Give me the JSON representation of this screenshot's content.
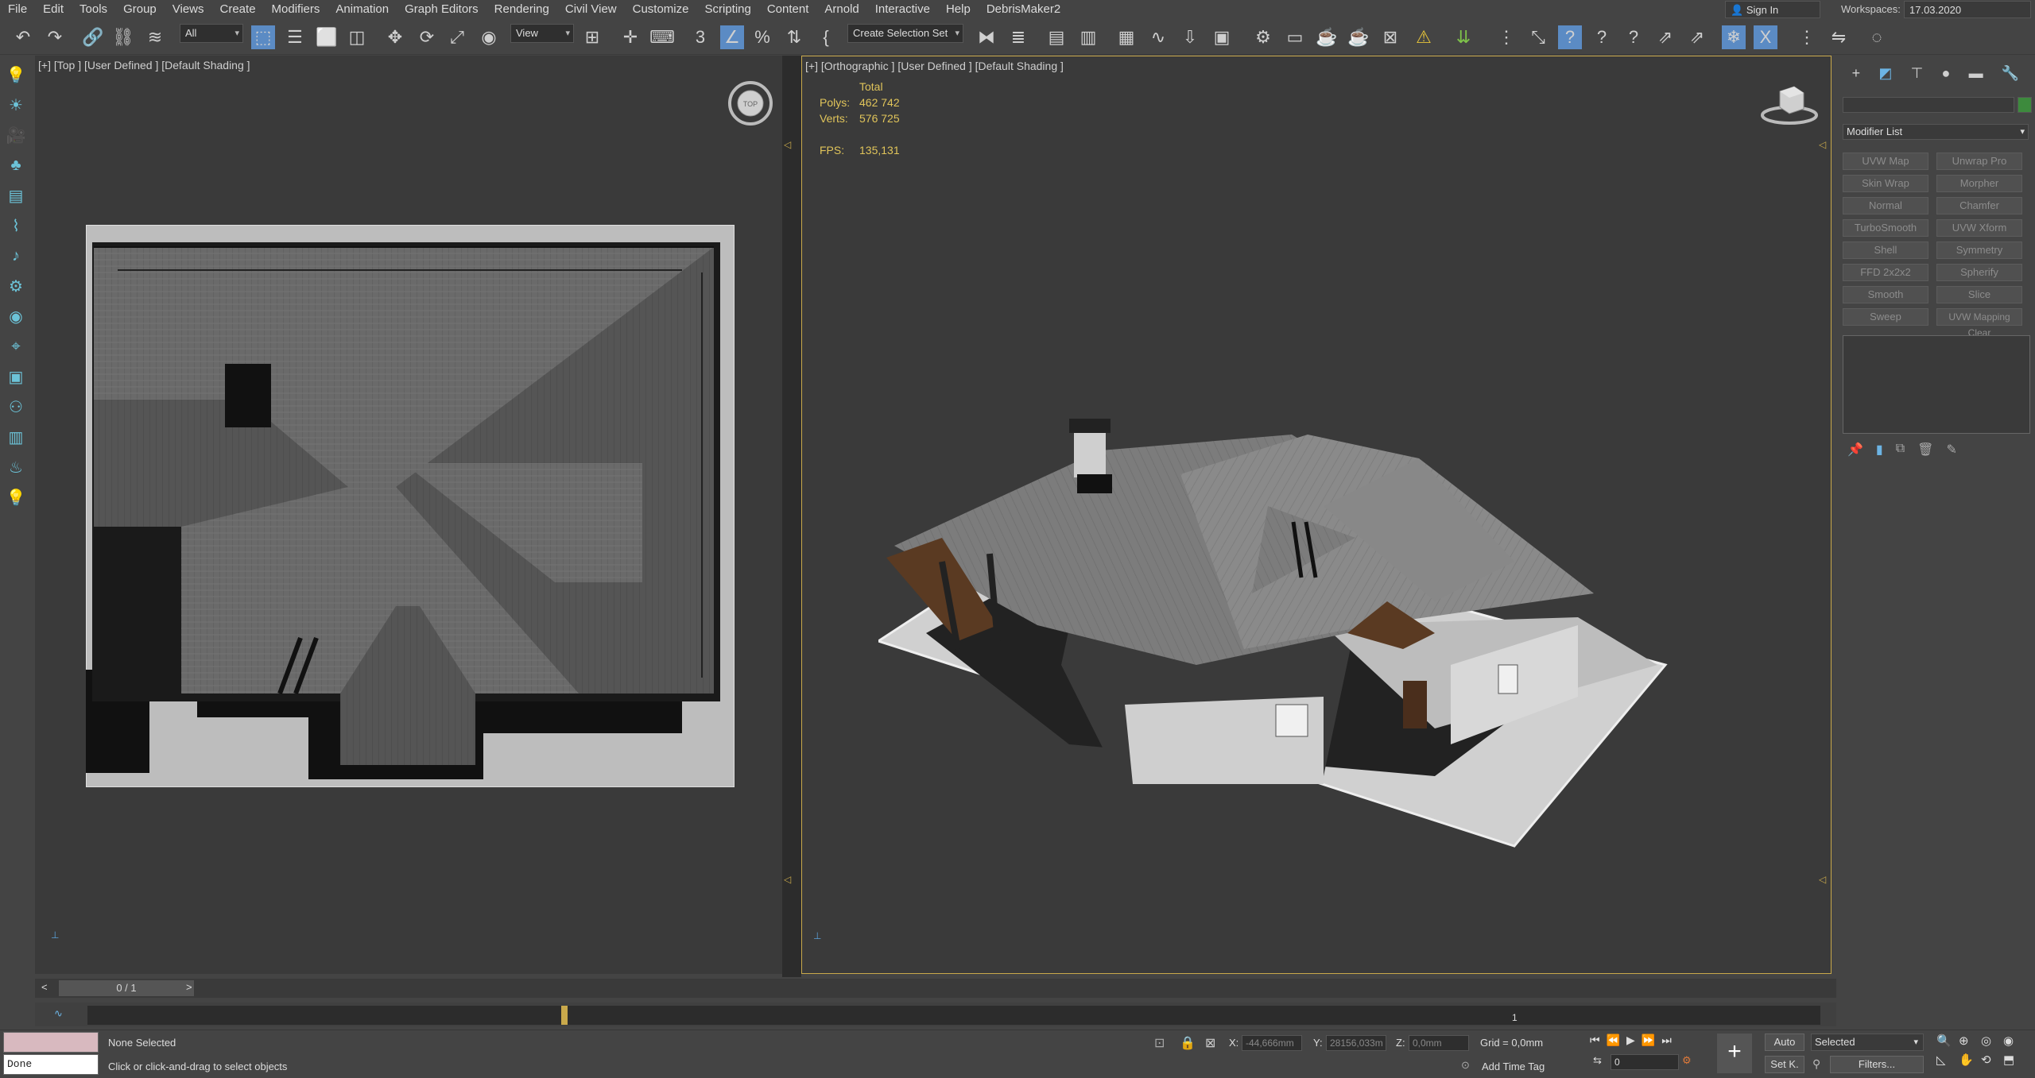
{
  "menu": [
    "File",
    "Edit",
    "Tools",
    "Group",
    "Views",
    "Create",
    "Modifiers",
    "Animation",
    "Graph Editors",
    "Rendering",
    "Civil View",
    "Customize",
    "Scripting",
    "Content",
    "Arnold",
    "Interactive",
    "Help",
    "DebrisMaker2"
  ],
  "account": {
    "sign_in": "Sign In"
  },
  "workspace": {
    "label": "Workspaces:",
    "value": "17.03.2020"
  },
  "toolbar": {
    "filter_select": "All",
    "coord_select": "View",
    "selection_set": "Create Selection Set"
  },
  "viewport_left": {
    "label": "[+] [Top ] [User Defined ] [Default Shading ]",
    "viewcube": "TOP"
  },
  "viewport_right": {
    "label": "[+] [Orthographic ] [User Defined ] [Default Shading ]",
    "stats": {
      "total_label": "Total",
      "polys_label": "Polys:",
      "polys_value": "462 742",
      "verts_label": "Verts:",
      "verts_value": "576 725",
      "fps_label": "FPS:",
      "fps_value": "135,131"
    }
  },
  "command_panel": {
    "modifier_list": "Modifier List",
    "modifiers": [
      [
        "UVW Map",
        "Unwrap Pro"
      ],
      [
        "Skin Wrap",
        "Morpher"
      ],
      [
        "Normal",
        "Chamfer"
      ],
      [
        "TurboSmooth",
        "UVW Xform"
      ],
      [
        "Shell",
        "Symmetry"
      ],
      [
        "FFD 2x2x2",
        "Spherify"
      ],
      [
        "Smooth",
        "Slice"
      ],
      [
        "Sweep",
        "UVW Mapping Clear"
      ]
    ]
  },
  "timeline": {
    "frame": "0 / 1",
    "prev": "<",
    "next": ">",
    "end_tick": "1"
  },
  "status": {
    "selection": "None Selected",
    "prompt": "Click or click-and-drag to select objects",
    "script_result": "Done",
    "x_label": "X:",
    "x_value": "-44,666mm",
    "y_label": "Y:",
    "y_value": "28156,033m",
    "z_label": "Z:",
    "z_value": "0,0mm",
    "grid": "Grid = 0,0mm",
    "time_tag": "Add Time Tag",
    "auto_key": "Auto",
    "set_key": "Set K.",
    "key_filter_select": "Selected",
    "filters": "Filters...",
    "frame_field": "0"
  },
  "colors": {
    "accent_blue": "#5b8bc4",
    "active_border": "#c9a94b",
    "stats_yellow": "#e0c45a"
  }
}
